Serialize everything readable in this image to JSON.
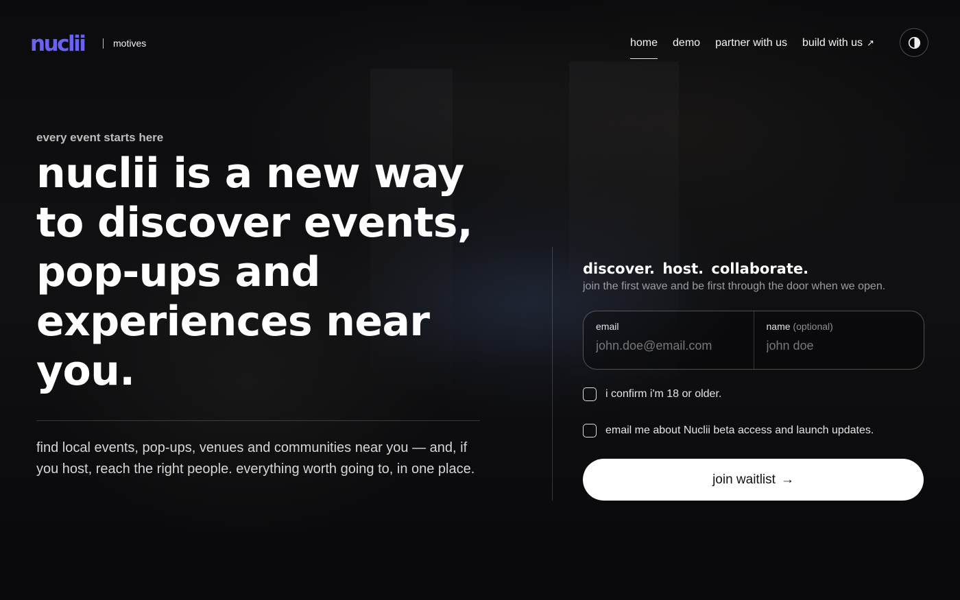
{
  "brand": {
    "logo": "nuclii",
    "subtitle": "motives",
    "color": "#6a63f2"
  },
  "nav": {
    "items": [
      {
        "label": "home",
        "active": true
      },
      {
        "label": "demo",
        "active": false
      },
      {
        "label": "partner with us",
        "active": false
      },
      {
        "label": "build with us",
        "active": false
      }
    ],
    "external_icon": "arrow-up-right-icon",
    "theme_icon": "contrast-icon"
  },
  "hero": {
    "eyebrow": "every event starts here",
    "headline": "nuclii is a new way to discover events, pop-ups and experiences near you.",
    "description": "find local events, pop-ups, venues and communities near you — and, if you host, reach the right people. everything worth going to, in one place."
  },
  "form": {
    "title": "discover. host. collaborate.",
    "subtitle": "join the first wave and be first through the door when we open.",
    "email": {
      "label": "email",
      "placeholder": "john.doe@email.com",
      "value": ""
    },
    "name": {
      "label": "name",
      "optional_text": "(optional)",
      "placeholder": "john doe",
      "value": ""
    },
    "checkboxes": [
      {
        "label": "i confirm i'm 18 or older.",
        "checked": false
      },
      {
        "label": "email me about Nuclii beta access and launch updates.",
        "checked": false
      }
    ],
    "button": {
      "label": "join waitlist",
      "icon": "arrow-right-icon"
    }
  }
}
